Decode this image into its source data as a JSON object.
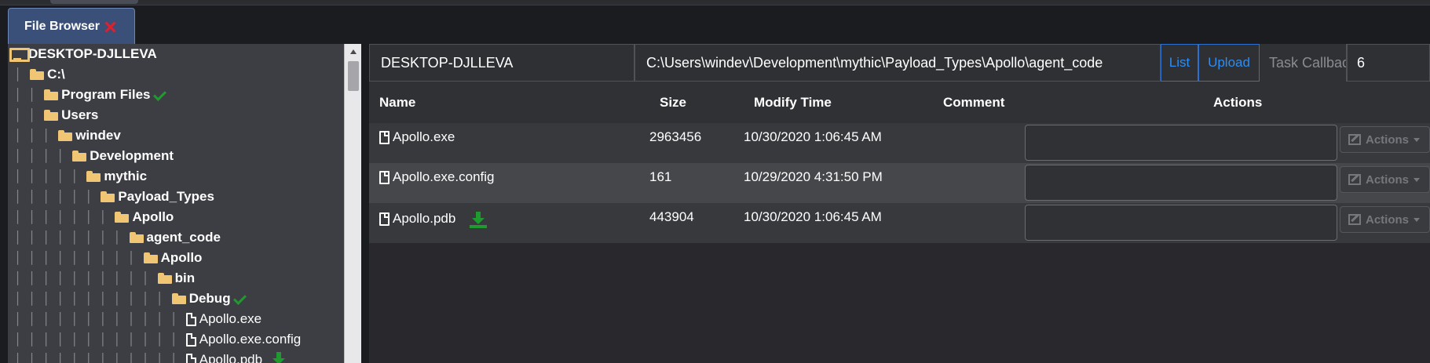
{
  "tab": {
    "label": "File Browser"
  },
  "tree": [
    {
      "pipes": "",
      "icon": "monitor-icon",
      "label": "DESKTOP-DJLLEVA",
      "bold": true
    },
    {
      "pipes": "│",
      "icon": "folder-icon",
      "label": "C:\\",
      "bold": true
    },
    {
      "pipes": "│ │",
      "icon": "folder-icon",
      "label": "Program Files",
      "bold": true,
      "check": true
    },
    {
      "pipes": "│ │",
      "icon": "folder-icon",
      "label": "Users",
      "bold": true
    },
    {
      "pipes": "│ │ │",
      "icon": "folder-icon",
      "label": "windev",
      "bold": true
    },
    {
      "pipes": "│ │ │ │",
      "icon": "folder-icon",
      "label": "Development",
      "bold": true
    },
    {
      "pipes": "│ │ │ │ │",
      "icon": "folder-icon",
      "label": "mythic",
      "bold": true
    },
    {
      "pipes": "│ │ │ │ │ │",
      "icon": "folder-icon",
      "label": "Payload_Types",
      "bold": true
    },
    {
      "pipes": "│ │ │ │ │ │ │",
      "icon": "folder-icon",
      "label": "Apollo",
      "bold": true
    },
    {
      "pipes": "│ │ │ │ │ │ │ │",
      "icon": "folder-icon",
      "label": "agent_code",
      "bold": true
    },
    {
      "pipes": "│ │ │ │ │ │ │ │ │",
      "icon": "folder-icon",
      "label": "Apollo",
      "bold": true
    },
    {
      "pipes": "│ │ │ │ │ │ │ │ │ │",
      "icon": "folder-icon",
      "label": "bin",
      "bold": true
    },
    {
      "pipes": "│ │ │ │ │ │ │ │ │ │ │",
      "icon": "folder-icon",
      "label": "Debug",
      "bold": true,
      "check": true
    },
    {
      "pipes": "│ │ │ │ │ │ │ │ │ │ │ │",
      "icon": "file-icon",
      "label": "Apollo.exe",
      "bold": false
    },
    {
      "pipes": "│ │ │ │ │ │ │ │ │ │ │ │",
      "icon": "file-icon",
      "label": "Apollo.exe.config",
      "bold": false
    },
    {
      "pipes": "│ │ │ │ │ │ │ │ │ │ │ │",
      "icon": "file-icon",
      "label": "Apollo.pdb",
      "bold": false,
      "download": true
    }
  ],
  "toolbar": {
    "host": "DESKTOP-DJLLEVA",
    "path": "C:\\Users\\windev\\Development\\mythic\\Payload_Types\\Apollo\\agent_code",
    "list_label": "List",
    "upload_label": "Upload",
    "task_label": "Task Callback",
    "task_value": "6"
  },
  "table": {
    "headers": {
      "name": "Name",
      "size": "Size",
      "modified": "Modify Time",
      "comment": "Comment",
      "actions": "Actions"
    },
    "rows": [
      {
        "name": "Apollo.exe",
        "size": "2963456",
        "modified": "10/30/2020 1:06:45 AM",
        "actions": "Actions",
        "download": false
      },
      {
        "name": "Apollo.exe.config",
        "size": "161",
        "modified": "10/29/2020 4:31:50 PM",
        "actions": "Actions",
        "download": false
      },
      {
        "name": "Apollo.pdb",
        "size": "443904",
        "modified": "10/30/2020 1:06:45 AM",
        "actions": "Actions",
        "download": true
      }
    ]
  },
  "colors": {
    "accent": "#2f8cf0",
    "folder": "#f0c574",
    "success": "#1f9a2f",
    "close": "#e0202a"
  }
}
